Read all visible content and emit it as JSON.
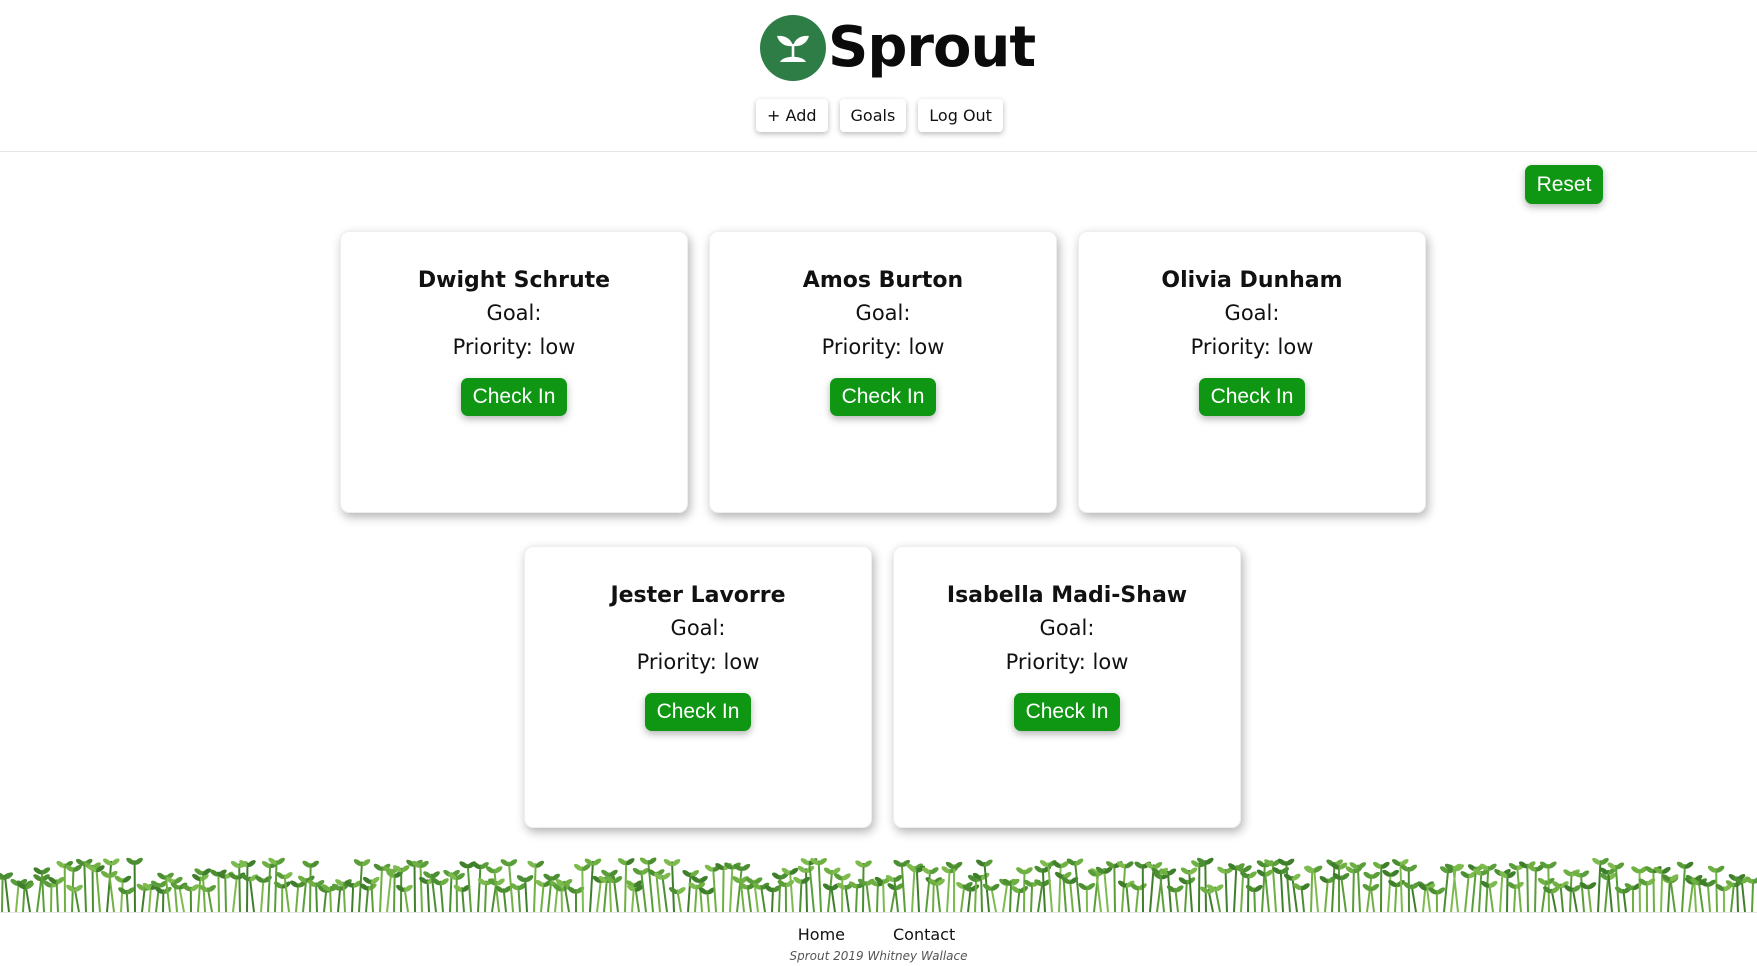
{
  "brand": {
    "name": "Sprout",
    "logo_icon": "sprout-icon",
    "logo_color": "#2f7d46"
  },
  "nav": [
    {
      "label": "+ Add"
    },
    {
      "label": "Goals"
    },
    {
      "label": "Log Out"
    }
  ],
  "reset_label": "Reset",
  "accent_color": "#0f9714",
  "cards": [
    {
      "name": "Dwight Schrute",
      "goal": "Goal:",
      "priority": "Priority: low",
      "button": "Check In"
    },
    {
      "name": "Amos Burton",
      "goal": "Goal:",
      "priority": "Priority: low",
      "button": "Check In"
    },
    {
      "name": "Olivia Dunham",
      "goal": "Goal:",
      "priority": "Priority: low",
      "button": "Check In"
    },
    {
      "name": "Jester Lavorre",
      "goal": "Goal:",
      "priority": "Priority: low",
      "button": "Check In"
    },
    {
      "name": "Isabella Madi-Shaw",
      "goal": "Goal:",
      "priority": "Priority: low",
      "button": "Check In"
    }
  ],
  "footer": {
    "links": [
      {
        "label": "Home"
      },
      {
        "label": "Contact"
      }
    ],
    "copyright": "Sprout 2019 Whitney Wallace"
  }
}
